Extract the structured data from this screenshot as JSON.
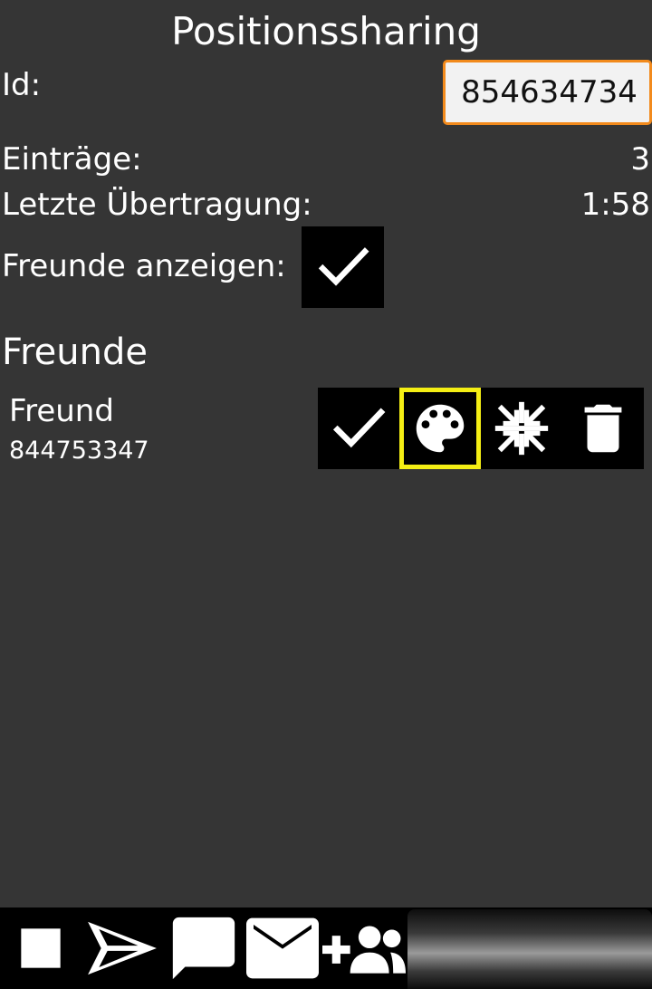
{
  "header": {
    "title": "Positionssharing"
  },
  "id_field": {
    "label": "Id:",
    "value": "854634734"
  },
  "stats": {
    "entries_label": "Einträge:",
    "entries_value": "3",
    "last_transfer_label": "Letzte Übertragung:",
    "last_transfer_value": "1:58"
  },
  "show_friends": {
    "label": "Freunde anzeigen:",
    "checked": true
  },
  "friends": {
    "section_title": "Freunde",
    "items": [
      {
        "name": "Freund",
        "id": "844753347"
      }
    ]
  },
  "colors": {
    "background": "#353535",
    "id_border": "#f28a1c",
    "selected_outline": "#f4ee14"
  },
  "icons": {
    "friend_actions": [
      "check-icon",
      "palette-icon",
      "collapse-arrows-icon",
      "trash-icon"
    ],
    "bottom_bar": [
      "stop-icon",
      "send-icon",
      "chat-icon",
      "mail-icon",
      "add-group-icon"
    ]
  }
}
